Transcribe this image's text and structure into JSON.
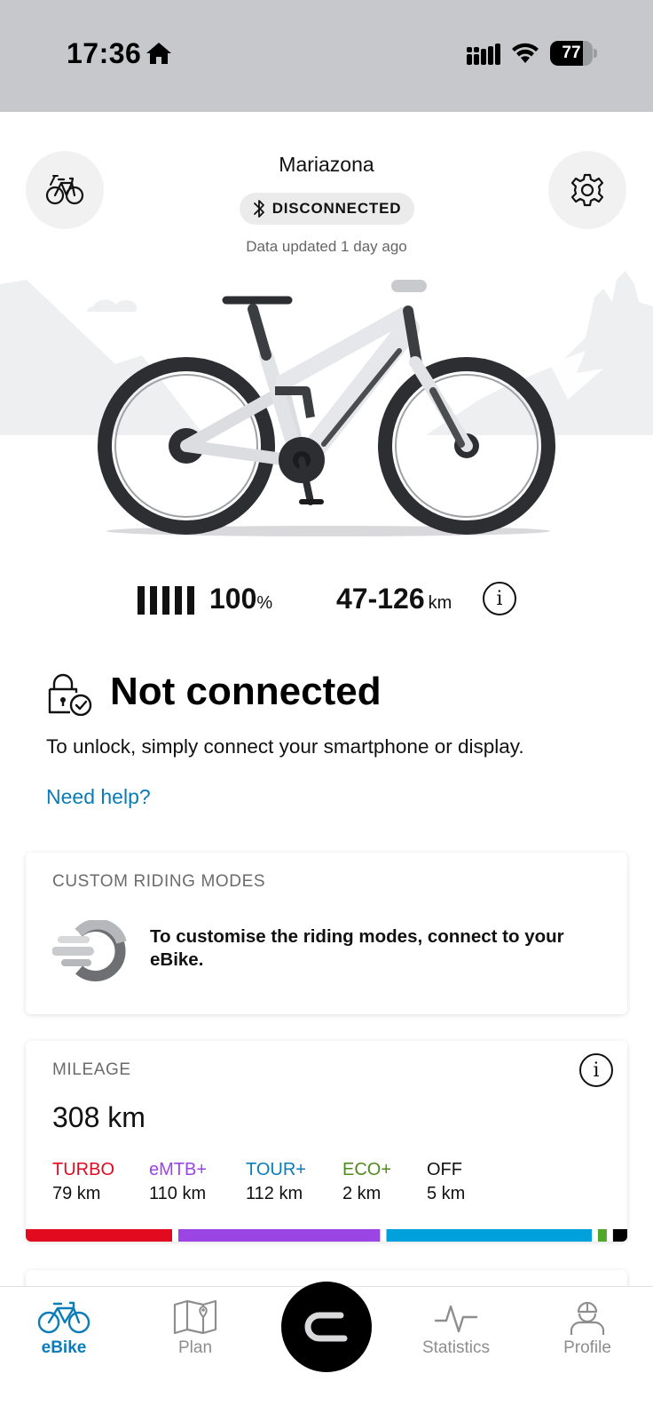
{
  "status_bar": {
    "time": "17:36",
    "battery_level": "77",
    "battery_fraction": 0.77
  },
  "header": {
    "bike_name": "Mariazona",
    "connection_status": "DISCONNECTED",
    "data_updated": "Data updated 1 day ago"
  },
  "bike_stats": {
    "battery_percent": "100",
    "battery_unit": "%",
    "range": "47-126",
    "range_unit": "km"
  },
  "lock_section": {
    "title": "Not connected",
    "description": "To unlock, simply connect your smartphone or display.",
    "help_link": "Need help?"
  },
  "riding_modes_card": {
    "label": "CUSTOM RIDING MODES",
    "message": "To customise the riding modes, connect to your eBike."
  },
  "mileage_card": {
    "label": "MILEAGE",
    "total": "308 km",
    "modes": [
      {
        "name": "TURBO",
        "value": "79 km",
        "km": 79,
        "color": "#e10a1e"
      },
      {
        "name": "eMTB+",
        "value": "110 km",
        "km": 110,
        "color": "#9b45e4"
      },
      {
        "name": "TOUR+",
        "value": "112 km",
        "km": 112,
        "color": "#00a0dc"
      },
      {
        "name": "ECO+",
        "value": "2 km",
        "km": 2,
        "color": "#4fa82a"
      },
      {
        "name": "OFF",
        "value": "5 km",
        "km": 5,
        "color": "#000000"
      }
    ]
  },
  "bottom_nav": {
    "items": [
      {
        "label": "eBike",
        "icon": "bike-icon",
        "active": true
      },
      {
        "label": "Plan",
        "icon": "map-icon",
        "active": false
      },
      {
        "label": "",
        "icon": "ride-start-icon",
        "active": false
      },
      {
        "label": "Statistics",
        "icon": "activity-icon",
        "active": false
      },
      {
        "label": "Profile",
        "icon": "profile-icon",
        "active": false
      }
    ]
  },
  "colors": {
    "accent": "#0a7cb8",
    "status_bar_bg": "#c7c8cb"
  }
}
